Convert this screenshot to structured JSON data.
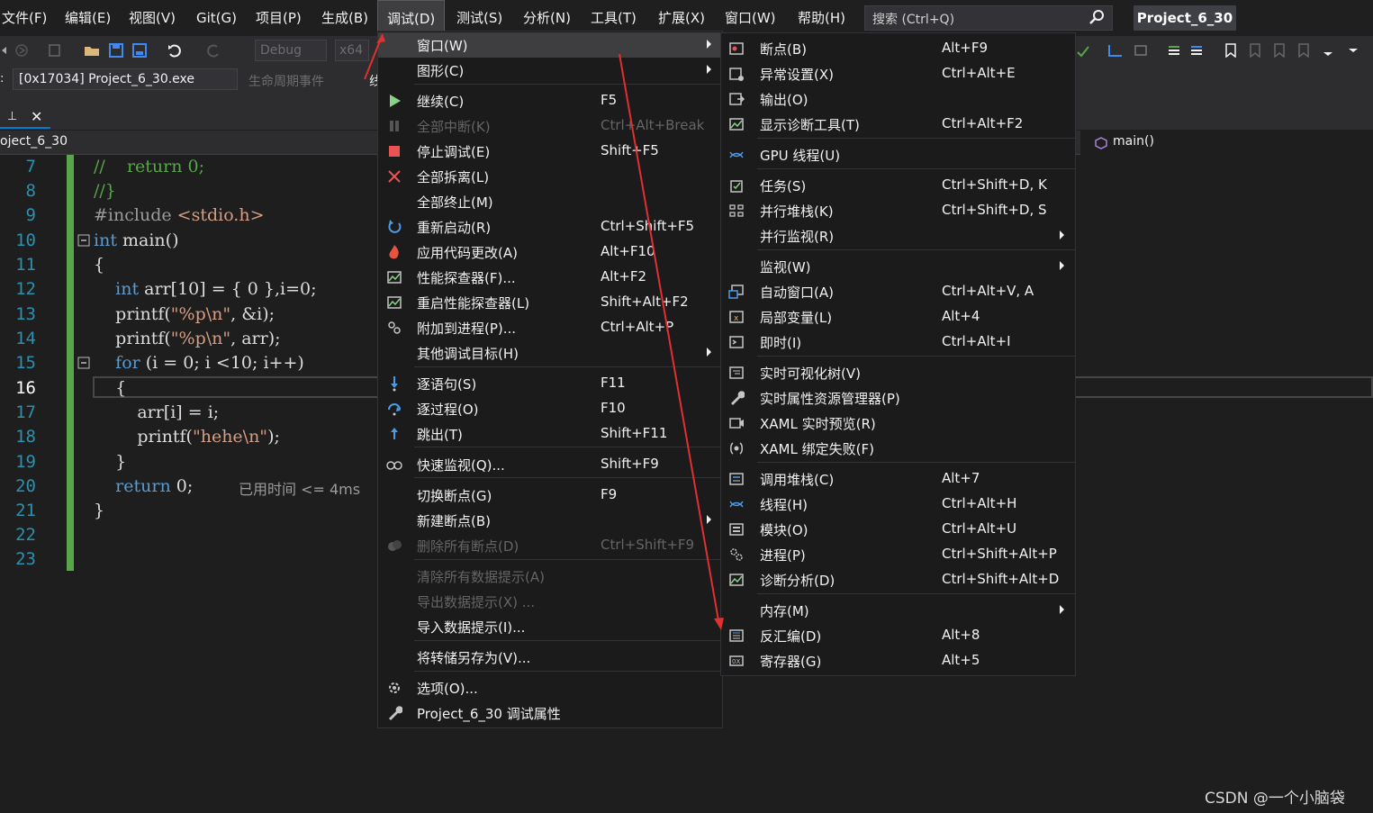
{
  "menubar": {
    "items": [
      "文件(F)",
      "编辑(E)",
      "视图(V)",
      "Git(G)",
      "项目(P)",
      "生成(B)",
      "调试(D)",
      "测试(S)",
      "分析(N)",
      "工具(T)",
      "扩展(X)",
      "窗口(W)",
      "帮助(H)"
    ],
    "search_placeholder": "搜索 (Ctrl+Q)",
    "project_name": "Project_6_30"
  },
  "toolbar": {
    "configuration": "Debug",
    "platform": "x64",
    "process_label": ":",
    "process": "[0x17034] Project_6_30.exe",
    "lifecycle": "生命周期事件",
    "lifecycle_partial": "线"
  },
  "navbar": {
    "project": "oject_6_30",
    "function": "main()"
  },
  "editor": {
    "line_numbers": [
      "7",
      "8",
      "9",
      "10",
      "11",
      "12",
      "13",
      "14",
      "15",
      "16",
      "17",
      "18",
      "19",
      "20",
      "21",
      "22",
      "23"
    ],
    "current_line": "16",
    "perf_tip": "已用时间 <= 4ms"
  },
  "debug_menu": {
    "items": [
      {
        "label": "窗口(W)",
        "shortcut": "",
        "submenu": true,
        "highlighted": true,
        "icon": "none"
      },
      {
        "label": "图形(C)",
        "shortcut": "",
        "submenu": true,
        "icon": "none"
      },
      {
        "label": "继续(C)",
        "shortcut": "F5",
        "icon": "play-icon"
      },
      {
        "label": "全部中断(K)",
        "shortcut": "Ctrl+Alt+Break",
        "disabled": true,
        "icon": "pause-icon"
      },
      {
        "label": "停止调试(E)",
        "shortcut": "Shift+F5",
        "icon": "stop-icon"
      },
      {
        "label": "全部拆离(L)",
        "shortcut": "",
        "icon": "detach-icon"
      },
      {
        "label": "全部终止(M)",
        "shortcut": "",
        "icon": "none"
      },
      {
        "label": "重新启动(R)",
        "shortcut": "Ctrl+Shift+F5",
        "icon": "restart-icon"
      },
      {
        "label": "应用代码更改(A)",
        "shortcut": "Alt+F10",
        "icon": "hot-reload-icon"
      },
      {
        "label": "性能探查器(F)...",
        "shortcut": "Alt+F2",
        "icon": "profiler-icon"
      },
      {
        "label": "重启性能探查器(L)",
        "shortcut": "Shift+Alt+F2",
        "icon": "profiler-icon"
      },
      {
        "label": "附加到进程(P)...",
        "shortcut": "Ctrl+Alt+P",
        "icon": "attach-icon"
      },
      {
        "label": "其他调试目标(H)",
        "shortcut": "",
        "submenu": true,
        "icon": "none"
      },
      {
        "label": "逐语句(S)",
        "shortcut": "F11",
        "icon": "step-into-icon"
      },
      {
        "label": "逐过程(O)",
        "shortcut": "F10",
        "icon": "step-over-icon"
      },
      {
        "label": "跳出(T)",
        "shortcut": "Shift+F11",
        "icon": "step-out-icon"
      },
      {
        "label": "快速监视(Q)...",
        "shortcut": "Shift+F9",
        "icon": "glasses-icon"
      },
      {
        "label": "切换断点(G)",
        "shortcut": "F9",
        "icon": "none"
      },
      {
        "label": "新建断点(B)",
        "shortcut": "",
        "submenu": true,
        "icon": "none"
      },
      {
        "label": "删除所有断点(D)",
        "shortcut": "Ctrl+Shift+F9",
        "disabled": true,
        "icon": "delete-breakpoints-icon"
      },
      {
        "label": "清除所有数据提示(A)",
        "shortcut": "",
        "disabled": true,
        "icon": "none"
      },
      {
        "label": "导出数据提示(X) ...",
        "shortcut": "",
        "disabled": true,
        "icon": "none"
      },
      {
        "label": "导入数据提示(I)...",
        "shortcut": "",
        "icon": "none"
      },
      {
        "label": "将转储另存为(V)...",
        "shortcut": "",
        "icon": "none"
      },
      {
        "label": "选项(O)...",
        "shortcut": "",
        "icon": "gear-icon"
      },
      {
        "label": "Project_6_30 调试属性",
        "shortcut": "",
        "icon": "wrench-icon"
      }
    ]
  },
  "window_submenu": {
    "items": [
      {
        "label": "断点(B)",
        "shortcut": "Alt+F9",
        "icon": "breakpoints-window-icon"
      },
      {
        "label": "异常设置(X)",
        "shortcut": "Ctrl+Alt+E",
        "icon": "exception-icon"
      },
      {
        "label": "输出(O)",
        "shortcut": "",
        "icon": "output-icon"
      },
      {
        "label": "显示诊断工具(T)",
        "shortcut": "Ctrl+Alt+F2",
        "icon": "diagnostic-icon"
      },
      {
        "label": "GPU 线程(U)",
        "shortcut": "",
        "icon": "gpu-thread-icon"
      },
      {
        "label": "任务(S)",
        "shortcut": "Ctrl+Shift+D, K",
        "icon": "tasks-icon"
      },
      {
        "label": "并行堆栈(K)",
        "shortcut": "Ctrl+Shift+D, S",
        "icon": "parallel-stacks-icon"
      },
      {
        "label": "并行监视(R)",
        "shortcut": "",
        "submenu": true,
        "icon": "none"
      },
      {
        "label": "监视(W)",
        "shortcut": "",
        "submenu": true,
        "icon": "none"
      },
      {
        "label": "自动窗口(A)",
        "shortcut": "Ctrl+Alt+V, A",
        "icon": "autos-icon"
      },
      {
        "label": "局部变量(L)",
        "shortcut": "Alt+4",
        "icon": "locals-icon"
      },
      {
        "label": "即时(I)",
        "shortcut": "Ctrl+Alt+I",
        "icon": "immediate-icon"
      },
      {
        "label": "实时可视化树(V)",
        "shortcut": "",
        "icon": "visual-tree-icon"
      },
      {
        "label": "实时属性资源管理器(P)",
        "shortcut": "",
        "icon": "property-explorer-icon"
      },
      {
        "label": "XAML 实时预览(R)",
        "shortcut": "",
        "icon": "xaml-preview-icon"
      },
      {
        "label": "XAML 绑定失败(F)",
        "shortcut": "",
        "icon": "xaml-binding-icon"
      },
      {
        "label": "调用堆栈(C)",
        "shortcut": "Alt+7",
        "icon": "call-stack-icon"
      },
      {
        "label": "线程(H)",
        "shortcut": "Ctrl+Alt+H",
        "icon": "threads-icon"
      },
      {
        "label": "模块(O)",
        "shortcut": "Ctrl+Alt+U",
        "icon": "modules-icon"
      },
      {
        "label": "进程(P)",
        "shortcut": "Ctrl+Shift+Alt+P",
        "icon": "processes-icon"
      },
      {
        "label": "诊断分析(D)",
        "shortcut": "Ctrl+Shift+Alt+D",
        "icon": "diagnostic-analysis-icon"
      },
      {
        "label": "内存(M)",
        "shortcut": "",
        "submenu": true,
        "icon": "none"
      },
      {
        "label": "反汇编(D)",
        "shortcut": "Alt+8",
        "icon": "disassembly-icon"
      },
      {
        "label": "寄存器(G)",
        "shortcut": "Alt+5",
        "icon": "registers-icon"
      }
    ]
  },
  "watermark": "CSDN @一个小脑袋",
  "colors": {
    "menu_bg": "#1b1b1c",
    "highlight": "#3e3e40",
    "accent": "#007acc",
    "annotation_arrow": "#e03030",
    "change_bar": "#57a64a"
  }
}
